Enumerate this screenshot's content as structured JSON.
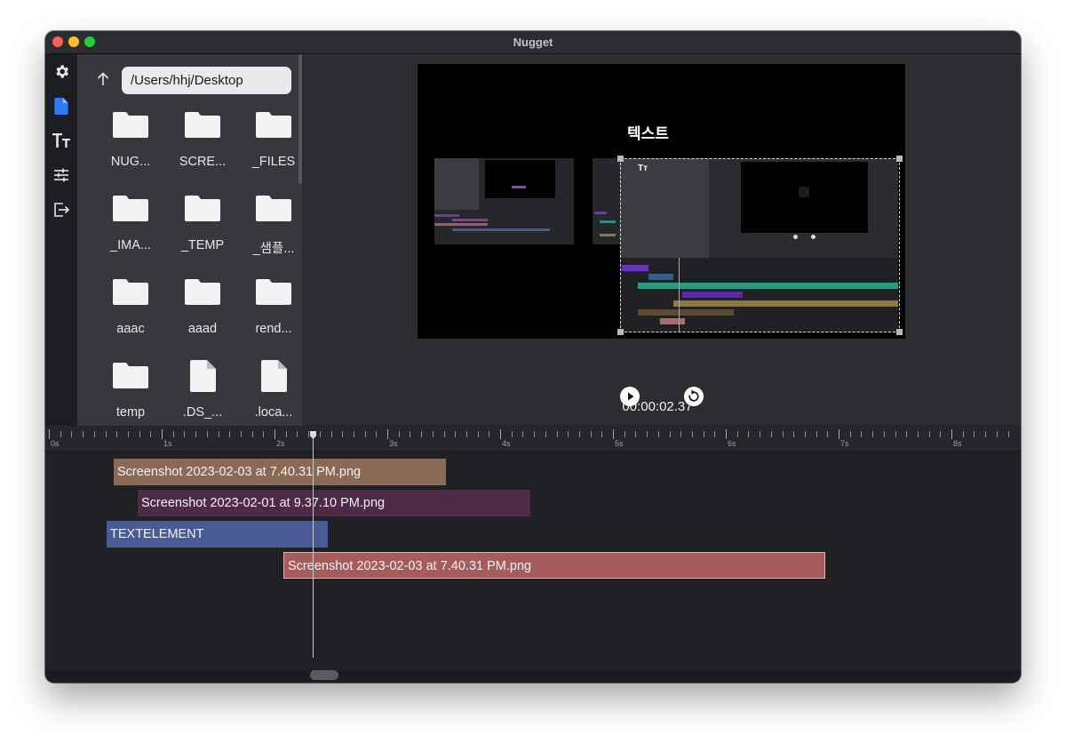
{
  "window": {
    "title": "Nugget"
  },
  "sidebar": {
    "icons": [
      "gear-icon",
      "file-icon",
      "text-icon",
      "sliders-icon",
      "export-icon"
    ],
    "active": "file-icon"
  },
  "file_browser": {
    "path": "/Users/hhj/Desktop",
    "items": [
      {
        "name": "NUG...",
        "type": "folder"
      },
      {
        "name": "SCRE...",
        "type": "folder"
      },
      {
        "name": "_FILES",
        "type": "folder"
      },
      {
        "name": "_IMA...",
        "type": "folder"
      },
      {
        "name": "_TEMP",
        "type": "folder"
      },
      {
        "name": "_샘플...",
        "type": "folder"
      },
      {
        "name": "aaac",
        "type": "folder"
      },
      {
        "name": "aaad",
        "type": "folder"
      },
      {
        "name": "rend...",
        "type": "folder"
      },
      {
        "name": "temp",
        "type": "folder"
      },
      {
        "name": ".DS_...",
        "type": "file"
      },
      {
        "name": ".loca...",
        "type": "file"
      }
    ]
  },
  "preview": {
    "canvas_text": "텍스트",
    "timecode": "00:00:02.37"
  },
  "timeline": {
    "ruler_labels": [
      "0s",
      "1s",
      "2s",
      "3s",
      "4s",
      "5s",
      "6s",
      "7s",
      "8s"
    ],
    "clips": [
      {
        "label": "Screenshot 2023-02-03 at 7.40.31 PM.png",
        "color": "#8a6a55"
      },
      {
        "label": "Screenshot 2023-02-01 at 9.37.10 PM.png",
        "color": "#4c2a48"
      },
      {
        "label": "TEXTELEMENT",
        "color": "#4a5a95"
      },
      {
        "label": "Screenshot 2023-02-03 at 7.40.31 PM.png",
        "color": "#a65c5c"
      }
    ]
  }
}
